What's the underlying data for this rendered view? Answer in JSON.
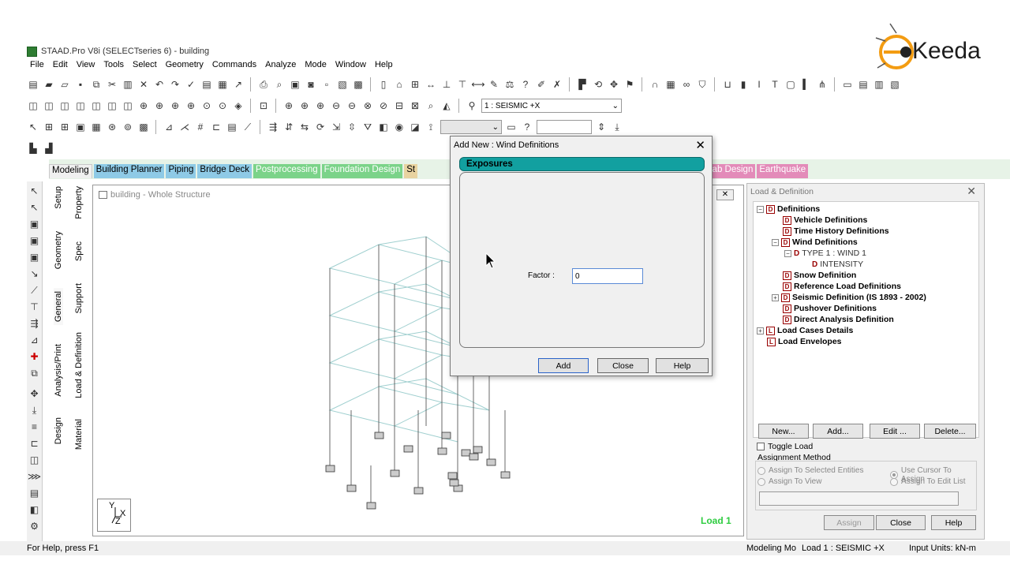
{
  "window": {
    "title": "STAAD.Pro V8i (SELECTseries 6) - building"
  },
  "menu": [
    "File",
    "Edit",
    "View",
    "Tools",
    "Select",
    "Geometry",
    "Commands",
    "Analyze",
    "Mode",
    "Window",
    "Help"
  ],
  "toolbar": {
    "load_combo": "1 : SEISMIC +X"
  },
  "tabs": {
    "modeling": "Modeling",
    "building_planner": "Building Planner",
    "piping": "Piping",
    "bridge_deck": "Bridge Deck",
    "postprocessing": "Postprocessing",
    "foundation_design": "Foundation Design",
    "steel_partial": "St",
    "slab_partial": "lab Design",
    "earthquake": "Earthquake"
  },
  "side_tabs": {
    "setup": "Setup",
    "geometry": "Geometry",
    "general": "General",
    "analysis_print": "Analysis/Print",
    "design": "Design",
    "property": "Property",
    "spec": "Spec",
    "support": "Support",
    "load_definition": "Load & Definition",
    "material": "Material"
  },
  "viewport": {
    "title": "building - Whole Structure",
    "load_label": "Load 1",
    "axis_y": "Y",
    "axis_x": "X",
    "axis_z": "Z"
  },
  "dialog": {
    "title": "Add New : Wind Definitions",
    "section": "Exposures",
    "factor_label": "Factor :",
    "factor_value": "0",
    "add": "Add",
    "close": "Close",
    "help": "Help"
  },
  "panel": {
    "title": "Load & Definition",
    "tree": {
      "definitions": "Definitions",
      "vehicle": "Vehicle Definitions",
      "time_history": "Time History Definitions",
      "wind": "Wind Definitions",
      "type1": "TYPE 1 : WIND 1",
      "intensity": "INTENSITY",
      "snow": "Snow Definition",
      "reference": "Reference Load Definitions",
      "seismic": "Seismic Definition (IS 1893 - 2002)",
      "pushover": "Pushover Definitions",
      "direct": "Direct Analysis Definition",
      "load_cases": "Load Cases Details",
      "load_envelopes": "Load Envelopes"
    },
    "buttons": {
      "new": "New...",
      "add": "Add...",
      "edit": "Edit ...",
      "delete": "Delete..."
    },
    "toggle_load": "Toggle Load",
    "assignment_method": "Assignment Method",
    "assign_selected": "Assign To Selected Entities",
    "assign_view": "Assign To View",
    "use_cursor": "Use Cursor To Assign",
    "assign_edit": "Assign To Edit List",
    "assign": "Assign",
    "close": "Close",
    "help": "Help"
  },
  "status": {
    "help": "For Help, press F1",
    "mode": "Modeling Mo",
    "load": "Load 1 : SEISMIC +X",
    "units": "Input Units:  kN-m"
  },
  "brand": {
    "name": "Keeda",
    "accent": "#f39c12"
  }
}
